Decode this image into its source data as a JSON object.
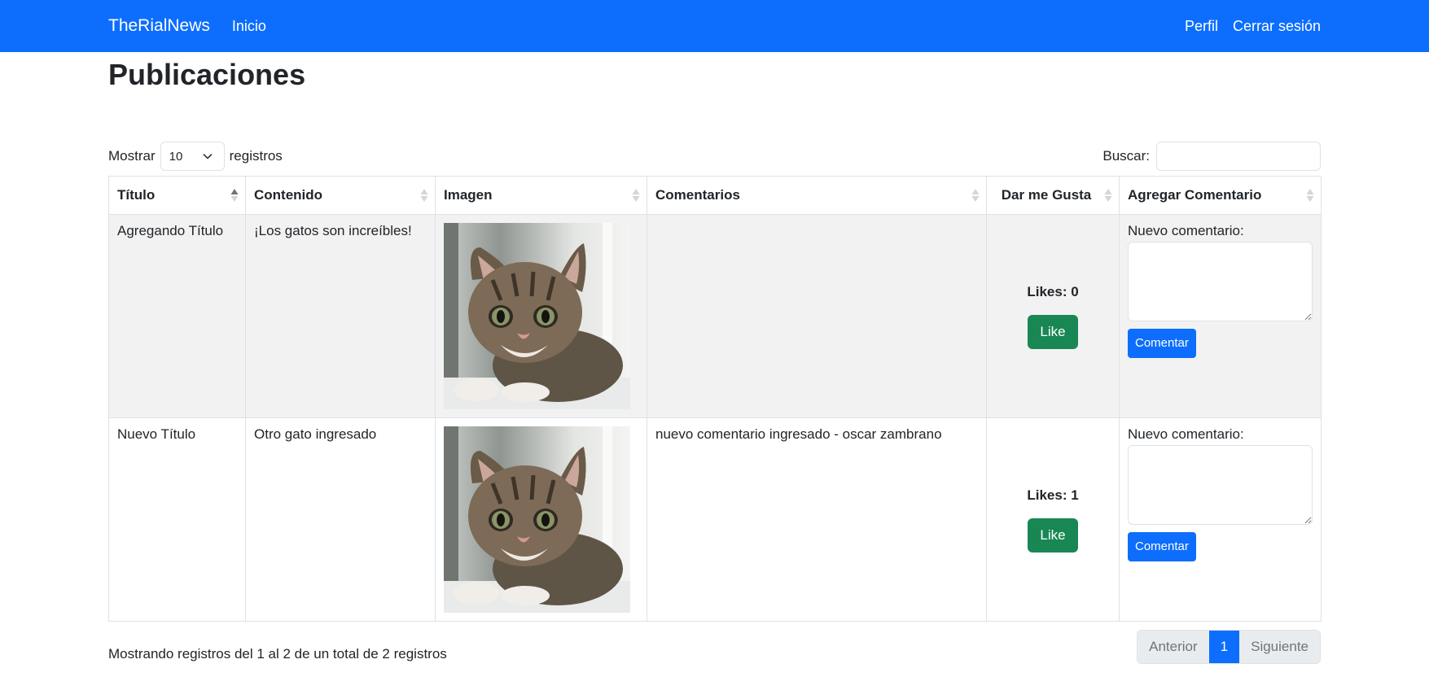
{
  "navbar": {
    "brand": "TheRialNews",
    "home": "Inicio",
    "profile": "Perfil",
    "logout": "Cerrar sesión"
  },
  "page": {
    "title": "Publicaciones"
  },
  "controls": {
    "show_label": "Mostrar",
    "page_length": "10",
    "records_label": "registros",
    "search_label": "Buscar:",
    "search_value": ""
  },
  "table": {
    "headers": [
      "Título",
      "Contenido",
      "Imagen",
      "Comentarios",
      "Dar me Gusta",
      "Agregar Comentario"
    ],
    "rows": [
      {
        "title": "Agregando Título",
        "content": "¡Los gatos son increíbles!",
        "image": "kitten-photo",
        "comments": "",
        "likes": "Likes: 0",
        "like_label": "Like",
        "new_comment_label": "Nuevo comentario:",
        "comment_value": "",
        "comment_button": "Comentar"
      },
      {
        "title": "Nuevo Título",
        "content": "Otro gato ingresado",
        "image": "kitten-photo",
        "comments": "nuevo comentario ingresado - oscar zambrano",
        "likes": "Likes: 1",
        "like_label": "Like",
        "new_comment_label": "Nuevo comentario:",
        "comment_value": "",
        "comment_button": "Comentar"
      }
    ]
  },
  "footer": {
    "info": "Mostrando registros del 1 al 2 de un total de 2 registros",
    "prev": "Anterior",
    "current_page": "1",
    "next": "Siguiente"
  },
  "colors": {
    "primary": "#0d6efd",
    "success": "#198754",
    "striped_row": "#f2f2f2"
  }
}
